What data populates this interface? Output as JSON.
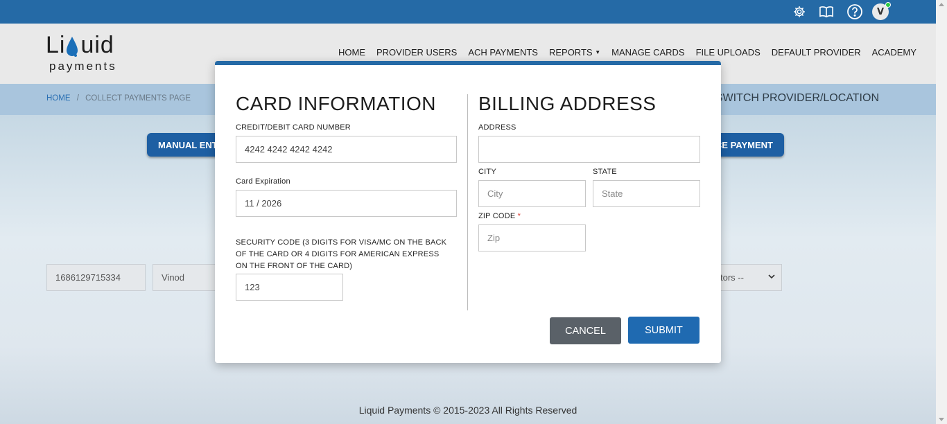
{
  "topbar": {
    "icons": [
      "gear-icon",
      "book-icon",
      "help-icon"
    ],
    "avatar_initial": "V"
  },
  "logo": {
    "word_left": "Li",
    "word_right": "uid",
    "sub": "payments"
  },
  "nav": {
    "items": [
      "HOME",
      "PROVIDER USERS",
      "ACH PAYMENTS",
      "REPORTS",
      "MANAGE CARDS",
      "FILE UPLOADS",
      "DEFAULT PROVIDER",
      "ACADEMY"
    ]
  },
  "breadcrumb": {
    "home": "HOME",
    "separator": "/",
    "current": "COLLECT PAYMENTS PAGE"
  },
  "switch_label": "SWITCH PROVIDER/LOCATION",
  "background": {
    "left_button": "MANUAL ENT",
    "right_button": "CE PAYMENT",
    "field_1": "1686129715334",
    "field_2": "Vinod",
    "select_partial": "tors --"
  },
  "footer": "Liquid Payments © 2015-2023 All Rights Reserved",
  "modal": {
    "card": {
      "title": "CARD INFORMATION",
      "number_label": "CREDIT/DEBIT CARD NUMBER",
      "number_value": "4242 4242 4242 4242",
      "expiration_label": "Card Expiration",
      "expiration_value": "11 / 2026",
      "security_label": "SECURITY CODE (3 DIGITS FOR VISA/MC ON THE BACK OF THE CARD OR 4 DIGITS FOR AMERICAN EXPRESS ON THE FRONT OF THE CARD)",
      "security_value": "123"
    },
    "billing": {
      "title": "BILLING ADDRESS",
      "address_label": "ADDRESS",
      "address_value": "",
      "city_label": "CITY",
      "city_placeholder": "City",
      "state_label": "STATE",
      "state_placeholder": "State",
      "zip_label": "ZIP CODE",
      "zip_required": "*",
      "zip_placeholder": "Zip"
    },
    "cancel_label": "CANCEL",
    "submit_label": "SUBMIT"
  }
}
